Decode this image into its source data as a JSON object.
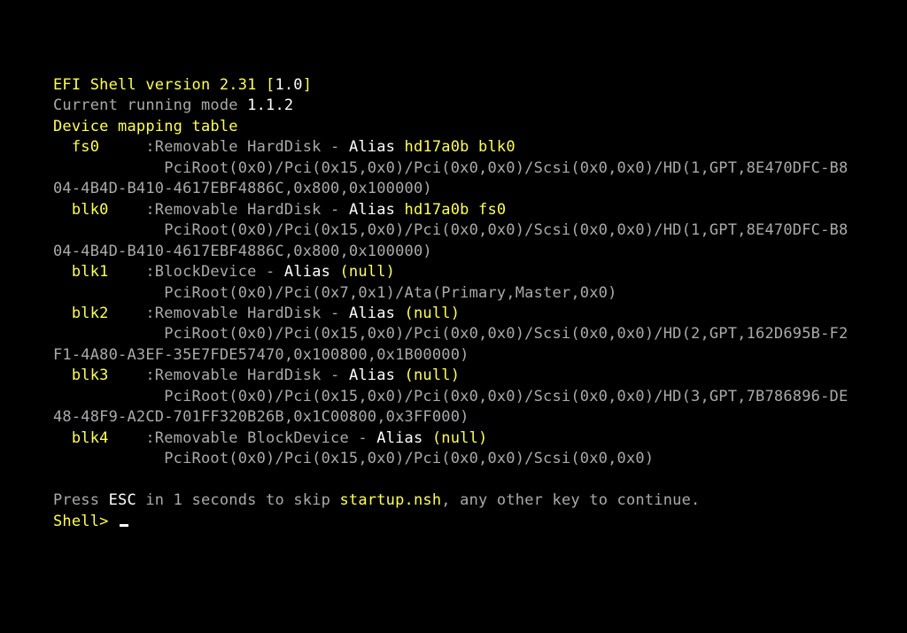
{
  "header": {
    "title_pre": "EFI Shell version 2.31 [",
    "title_ver": "1.0",
    "title_post": "]",
    "mode_label": "Current running mode ",
    "mode_value": "1.1.2",
    "table_label": "Device mapping table"
  },
  "entries": [
    {
      "name": "fs0",
      "type": "Removable HardDisk",
      "alias": "hd17a0b blk0",
      "path": "PciRoot(0x0)/Pci(0x15,0x0)/Pci(0x0,0x0)/Scsi(0x0,0x0)/HD(1,GPT,8E470DFC-B804-4B4D-B410-4617EBF4886C,0x800,0x100000)"
    },
    {
      "name": "blk0",
      "type": "Removable HardDisk",
      "alias": "hd17a0b fs0",
      "path": "PciRoot(0x0)/Pci(0x15,0x0)/Pci(0x0,0x0)/Scsi(0x0,0x0)/HD(1,GPT,8E470DFC-B804-4B4D-B410-4617EBF4886C,0x800,0x100000)"
    },
    {
      "name": "blk1",
      "type": "BlockDevice",
      "alias": "(null)",
      "path": "PciRoot(0x0)/Pci(0x7,0x1)/Ata(Primary,Master,0x0)"
    },
    {
      "name": "blk2",
      "type": "Removable HardDisk",
      "alias": "(null)",
      "path": "PciRoot(0x0)/Pci(0x15,0x0)/Pci(0x0,0x0)/Scsi(0x0,0x0)/HD(2,GPT,162D695B-F2F1-4A80-A3EF-35E7FDE57470,0x100800,0x1B00000)"
    },
    {
      "name": "blk3",
      "type": "Removable HardDisk",
      "alias": "(null)",
      "path": "PciRoot(0x0)/Pci(0x15,0x0)/Pci(0x0,0x0)/Scsi(0x0,0x0)/HD(3,GPT,7B786896-DE48-48F9-A2CD-701FF320B26B,0x1C00800,0x3FF000)"
    },
    {
      "name": "blk4",
      "type": "Removable BlockDevice",
      "alias": "(null)",
      "path": "PciRoot(0x0)/Pci(0x15,0x0)/Pci(0x0,0x0)/Scsi(0x0,0x0)"
    }
  ],
  "strings": {
    "alias_word": "Alias ",
    "sep": " - ",
    "colon": " :",
    "footer_pre": "Press ",
    "footer_key": "ESC",
    "footer_mid": " in 1 seconds to skip ",
    "footer_file": "startup.nsh",
    "footer_post": ", any other key to continue.",
    "prompt": "Shell> "
  },
  "layout": {
    "name_col": 2,
    "sep_col": 10,
    "path_col": 12,
    "line_width": 86
  }
}
